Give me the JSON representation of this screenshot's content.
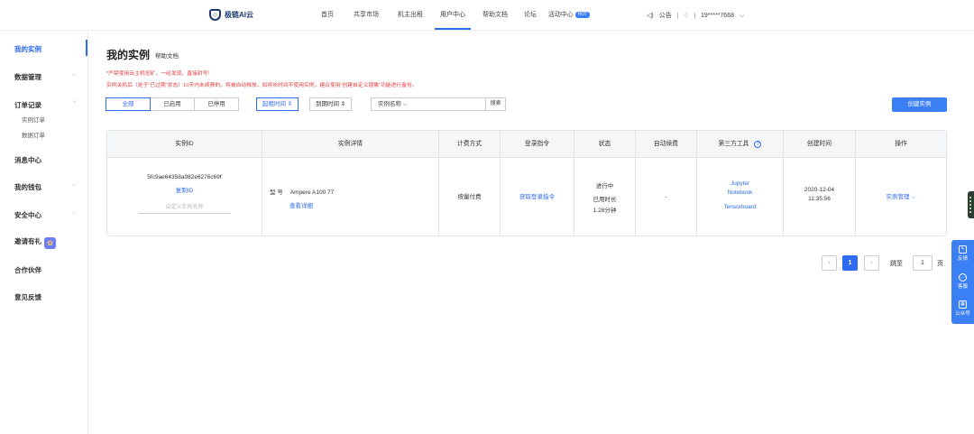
{
  "header": {
    "brand": "极链AI云",
    "brand_icon": "shield-logo",
    "nav": [
      "首页",
      "共享市场",
      "机主出租",
      "用户中心",
      "帮助文档",
      "论坛",
      "活动中心"
    ],
    "active_nav": "用户中心",
    "activity_badge": "HOT",
    "announcement_icon": "speaker-icon",
    "announcement": "公告",
    "bell_icon": "bell-icon",
    "user": "19*****7668",
    "accent": "#2d6cf0"
  },
  "sidebar": {
    "items": [
      {
        "label": "我的实例",
        "active": true
      },
      {
        "label": "数据管理"
      },
      {
        "label": "订单记录",
        "sub": [
          "实例订单",
          "数据订单"
        ]
      },
      {
        "label": "消息中心"
      },
      {
        "label": "我的钱包"
      },
      {
        "label": "安全中心"
      },
      {
        "label": "邀请有礼",
        "icon": "gift-icon"
      },
      {
        "label": "合作伙伴"
      },
      {
        "label": "意见反馈"
      }
    ]
  },
  "page": {
    "title": "我的实例",
    "help_link": "帮助文档",
    "warning1": "*严禁使用云主机挖矿，一经发现，直接封号！",
    "warning2": "实例关机后（处于“已过期”状态）10天内未续费的，将被自动释放。如将长时间不使用实例，建议使用“创建自定义镜像”功能进行备份。",
    "filters": [
      "全部",
      "已启用",
      "已停用"
    ],
    "active_filter": "全部",
    "sort1": "起租时间 ⇕",
    "sort2": "到期时间 ⇕",
    "search_placeholder": "实例名称 ⌵",
    "search_button": "搜索",
    "create_button": "创建实例"
  },
  "table": {
    "headers": [
      "实例ID",
      "实例详情",
      "计费方式",
      "登录指令",
      "状态",
      "自动续费",
      "第三方工具",
      "创建时间",
      "操作"
    ],
    "row": {
      "id": "5fc9ae64358a982e6276c69f",
      "copy_id": "复制ID",
      "name_placeholder": "自定义实例名称",
      "model_label": "型 号",
      "model": "Ampere A100 77",
      "view_detail": "查看详细",
      "billing": "按量付费",
      "login": "获取登录指令",
      "status": "进行中",
      "used_label": "已用时长",
      "used_time": "1.28分钟",
      "auto_renew": "-",
      "tool1": "Jupyter",
      "tool2": "Notebook",
      "tool3": "Tensorboard",
      "created_date": "2020-12-04",
      "created_time": "11:35:56",
      "action": "实例管理 ⌵"
    }
  },
  "pagination": {
    "prev": "‹",
    "current": "1",
    "next": "›",
    "jump_label": "跳至",
    "jump_value": "1",
    "page_unit": "页"
  },
  "float_bar": [
    "反馈",
    "客服",
    "公众号"
  ],
  "float_icons": [
    "feedback-icon",
    "chat-icon",
    "qrcode-icon"
  ]
}
